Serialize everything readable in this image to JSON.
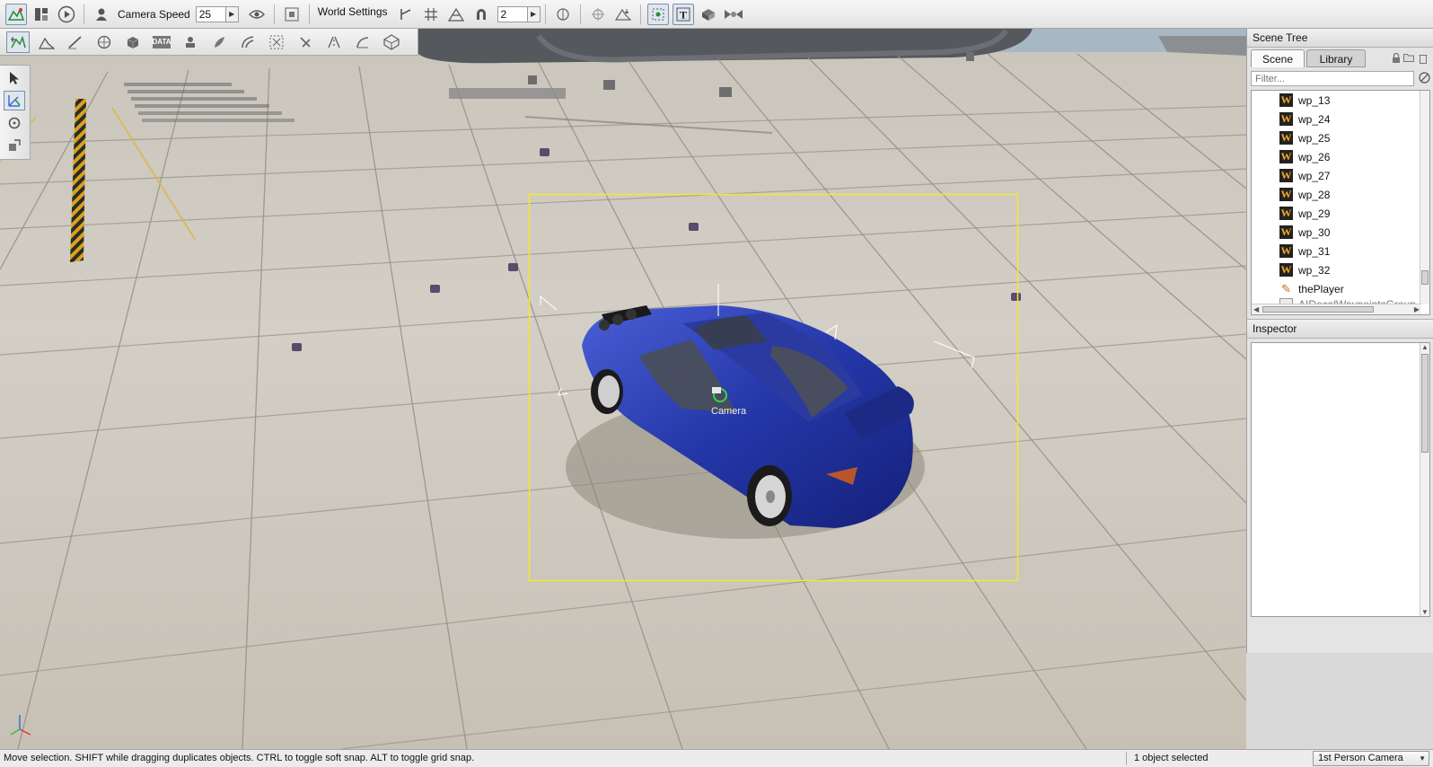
{
  "toolbar": {
    "camera_speed_label": "Camera Speed",
    "camera_speed_value": "25",
    "world_settings_label": "World Settings",
    "snap_value": "2"
  },
  "tools": {
    "data_button_label": "DATA"
  },
  "scene_tree": {
    "title": "Scene Tree",
    "tabs": [
      "Scene",
      "Library"
    ],
    "filter_placeholder": "Filter...",
    "items": [
      {
        "label": "wp_13",
        "icon": "waypoint-icon"
      },
      {
        "label": "wp_24",
        "icon": "waypoint-icon"
      },
      {
        "label": "wp_25",
        "icon": "waypoint-icon"
      },
      {
        "label": "wp_26",
        "icon": "waypoint-icon"
      },
      {
        "label": "wp_27",
        "icon": "waypoint-icon"
      },
      {
        "label": "wp_28",
        "icon": "waypoint-icon"
      },
      {
        "label": "wp_29",
        "icon": "waypoint-icon"
      },
      {
        "label": "wp_30",
        "icon": "waypoint-icon"
      },
      {
        "label": "wp_31",
        "icon": "waypoint-icon"
      },
      {
        "label": "wp_32",
        "icon": "waypoint-icon"
      },
      {
        "label": "thePlayer",
        "icon": "player-spawn-icon"
      },
      {
        "label": "AIDecalWaypointsGroup",
        "icon": "folder-icon"
      }
    ]
  },
  "inspector": {
    "title": "Inspector"
  },
  "viewport": {
    "camera_label": "Camera",
    "selection_box_color": "#f2e833",
    "vehicle_color": "#2437a8"
  },
  "status": {
    "message": "Move selection.  SHIFT while dragging duplicates objects.  CTRL to toggle soft snap.  ALT to toggle grid snap.",
    "selection_count": "1 object selected",
    "camera_mode": "1st Person Camera"
  }
}
